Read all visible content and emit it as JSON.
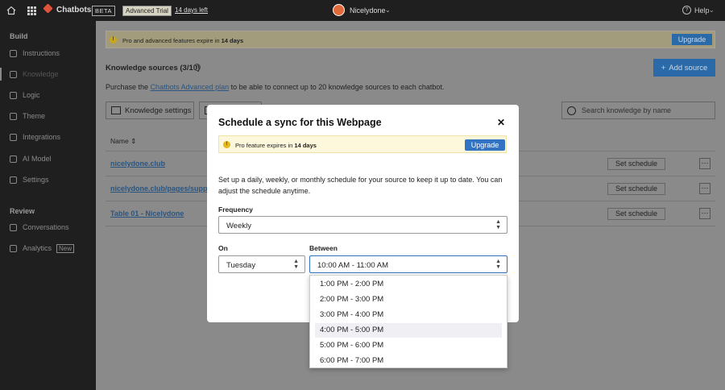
{
  "topbar": {
    "app_name": "Chatbots",
    "beta": "BETA",
    "trial_badge": "Advanced Trial",
    "days_left": "14 days left",
    "org_name": "Nicelydone",
    "help": "Help"
  },
  "sidebar": {
    "build_heading": "Build",
    "build_items": [
      {
        "label": "Instructions",
        "icon": "document-icon"
      },
      {
        "label": "Knowledge",
        "icon": "book-icon"
      },
      {
        "label": "Logic",
        "icon": "logic-icon"
      },
      {
        "label": "Theme",
        "icon": "theme-icon"
      },
      {
        "label": "Integrations",
        "icon": "integrations-icon"
      },
      {
        "label": "AI Model",
        "icon": "ai-model-icon"
      },
      {
        "label": "Settings",
        "icon": "settings-icon"
      }
    ],
    "review_heading": "Review",
    "review_items": [
      {
        "label": "Conversations",
        "icon": "conversations-icon"
      },
      {
        "label": "Analytics",
        "icon": "analytics-icon",
        "badge": "New"
      }
    ]
  },
  "main": {
    "banner_text_pre": "Pro and advanced features expire in",
    "banner_days": "14 days",
    "banner_upgrade": "Upgrade",
    "ks_title": "Knowledge sources (3/10)",
    "add_source": "Add source",
    "purchase_pre": "Purchase the",
    "purchase_link": "Chatbots Advanced plan",
    "purchase_post": "to be able to connect up to 20 knowledge sources to each chatbot.",
    "ks_settings": "Knowledge settings",
    "search_placeholder": "Search knowledge by name",
    "table_header_name": "Name",
    "rows": [
      {
        "name": "nicelydone.club",
        "action": "Set schedule"
      },
      {
        "name": "nicelydone.club/pages/support",
        "action": "Set schedule"
      },
      {
        "name": "Table 01 - Nicelydone",
        "action": "Set schedule"
      }
    ]
  },
  "modal": {
    "title": "Schedule a sync for this Webpage",
    "banner_pre": "Pro feature expires in",
    "banner_days": "14 days",
    "banner_upgrade": "Upgrade",
    "description": "Set up a daily, weekly, or monthly schedule for your source to keep it up to date. You can adjust the schedule anytime.",
    "frequency_label": "Frequency",
    "frequency_value": "Weekly",
    "on_label": "On",
    "on_value": "Tuesday",
    "between_label": "Between",
    "between_value": "10:00 AM - 11:00 AM"
  },
  "dropdown": {
    "options": [
      "1:00 PM - 2:00 PM",
      "2:00 PM - 3:00 PM",
      "3:00 PM - 4:00 PM",
      "4:00 PM - 5:00 PM",
      "5:00 PM - 6:00 PM",
      "6:00 PM - 7:00 PM"
    ],
    "highlighted_index": 3
  }
}
